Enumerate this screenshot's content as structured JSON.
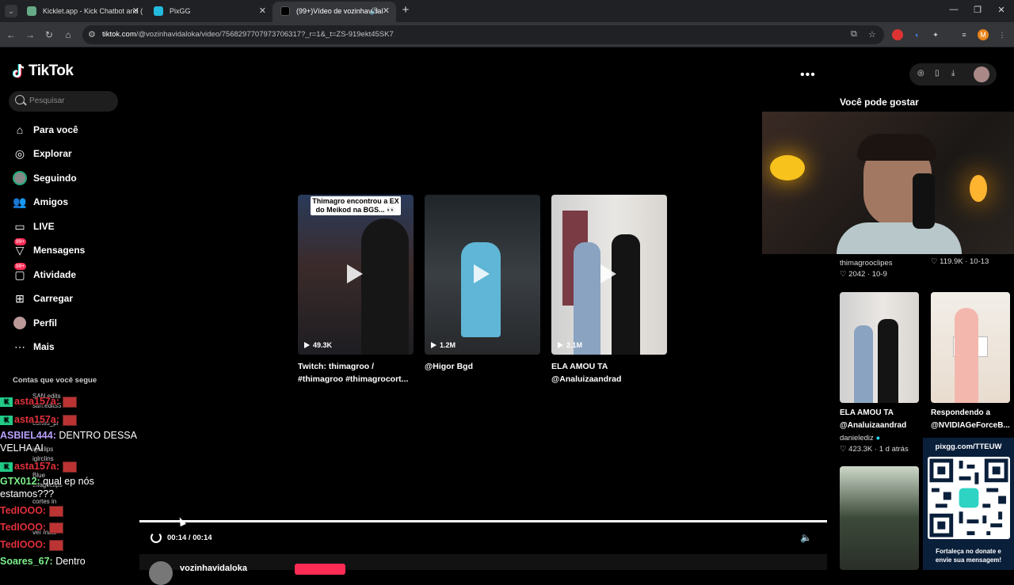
{
  "browser": {
    "tabs": [
      {
        "title": "Kicklet.app - Kick Chatbot and ("
      },
      {
        "title": "PixGG"
      },
      {
        "title": "(99+)Vídeo de vozinhavidal"
      }
    ],
    "url_domain": "tiktok.com",
    "url_path": "/@vozinhavidaloka/video/7568297707973706317?_r=1&_t=ZS-919ekt45SK7"
  },
  "tiktok": {
    "logo": "TikTok",
    "search_placeholder": "Pesquisar",
    "nav": [
      {
        "label": "Para você",
        "icon": "home-icon"
      },
      {
        "label": "Explorar",
        "icon": "compass-icon"
      },
      {
        "label": "Seguindo",
        "icon": "avatar-icon"
      },
      {
        "label": "Amigos",
        "icon": "friends-icon"
      },
      {
        "label": "LIVE",
        "icon": "live-icon"
      },
      {
        "label": "Mensagens",
        "icon": "message-icon",
        "badge": "99+"
      },
      {
        "label": "Atividade",
        "icon": "activity-icon",
        "badge": "99+"
      },
      {
        "label": "Carregar",
        "icon": "upload-icon"
      },
      {
        "label": "Perfil",
        "icon": "profile-icon"
      },
      {
        "label": "Mais",
        "icon": "more-icon"
      }
    ],
    "following_heading": "Contas que você segue",
    "following": [
      "SAN edits",
      "san.edits5",
      "cortes_pr",
      "igl.clips",
      "iglrclins",
      "Blue",
      "thiagoclips",
      "cortes in",
      "ver mais"
    ]
  },
  "chat": [
    {
      "user": "asta157a:",
      "msg": "",
      "color": "#e0303a"
    },
    {
      "user": "asta157a:",
      "msg": "",
      "color": "#e0303a"
    },
    {
      "user": "ASBIEL444:",
      "msg": "DENTRO DESSA",
      "color": "#b9a0ff"
    },
    {
      "user": "",
      "msg": "VELHA AI",
      "color": "#ffffff"
    },
    {
      "user": "asta157a:",
      "msg": "",
      "color": "#e0303a"
    },
    {
      "user": "GTX012:",
      "msg": "qual ep nós",
      "color": "#7cf08a"
    },
    {
      "user": "",
      "msg": "estamos???",
      "color": "#ffffff"
    },
    {
      "user": "TedIOOO:",
      "msg": "",
      "color": "#e0303a"
    },
    {
      "user": "TedIOOO:",
      "msg": "",
      "color": "#e0303a"
    },
    {
      "user": "TedIOOO:",
      "msg": "",
      "color": "#e0303a"
    },
    {
      "user": "Soares_67:",
      "msg": "Dentro",
      "color": "#7cf08a"
    }
  ],
  "grid": [
    {
      "views": "49.3K",
      "title1": "Twitch: thimagroo /",
      "title2": "#thimagroo #thimagrocort...",
      "caption": "Thimagro encontrou a EX do Meikod na BGS... 👀"
    },
    {
      "views": "1.2M",
      "title1": "@Higor Bgd",
      "title2": ""
    },
    {
      "views": "2.1M",
      "title1": "ELA AMOU TA",
      "title2": "@Analuizaandrad"
    }
  ],
  "player": {
    "time": "00:14 / 00:14",
    "progress_percent": 100,
    "author": "vozinhavidaloka"
  },
  "right": {
    "heading": "Você pode gostar",
    "items": [
      {
        "author": "thimagrooclipes",
        "likes": "2042",
        "date": "10-9"
      },
      {
        "author": "",
        "likes": "119.9K",
        "date": "10-13"
      },
      {
        "title1": "ELA AMOU TA",
        "title2": "@Analuizaandrad",
        "author": "danielediz",
        "likes": "423.3K",
        "date": "1 d atrás"
      },
      {
        "title1": "Respondendo a",
        "title2": "@NVIDIAGeForceB...",
        "author": "",
        "likes": "",
        "date": ""
      }
    ]
  },
  "qr": {
    "top": "pixgg.com/TTEUW",
    "bottom1": "Fortaleça no donate e",
    "bottom2": "envie sua mensagem!"
  }
}
